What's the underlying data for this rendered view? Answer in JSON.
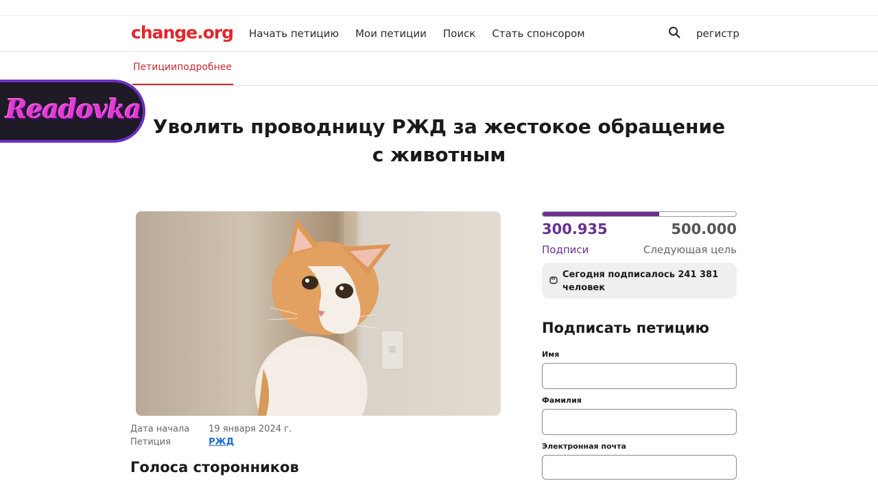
{
  "header": {
    "logo": "change.org",
    "nav": [
      "Начать петицию",
      "Мои петиции",
      "Поиск",
      "Стать спонсором"
    ],
    "register": "регистр"
  },
  "subnav": {
    "tab": "Петицииподробнее"
  },
  "overlay": {
    "brand": "Readovka",
    "brand_color": "#e43bd0",
    "border_color": "#6b2fc4"
  },
  "petition": {
    "title": "Уволить проводницу РЖД за жестокое обращение с животным",
    "photo_icon": "cat-photo",
    "start_date_label": "Дата начала",
    "start_date_value": "19 января 2024 г.",
    "petition_label": "Петиция",
    "petition_target": "РЖД",
    "supporters_heading": "Голоса сторонников"
  },
  "stats": {
    "count": "300.935",
    "goal": "500.000",
    "count_label": "Подписи",
    "goal_label": "Следующая цель",
    "progress_fraction": 0.6019,
    "accent": "#6a2f91",
    "today_text": "Сегодня подписалось 241 381 человек"
  },
  "form": {
    "title": "Подписать петицию",
    "first_name_label": "Имя",
    "last_name_label": "Фамилия",
    "email_label": "Электронная почта",
    "first_name_value": "",
    "last_name_value": "",
    "email_value": ""
  }
}
